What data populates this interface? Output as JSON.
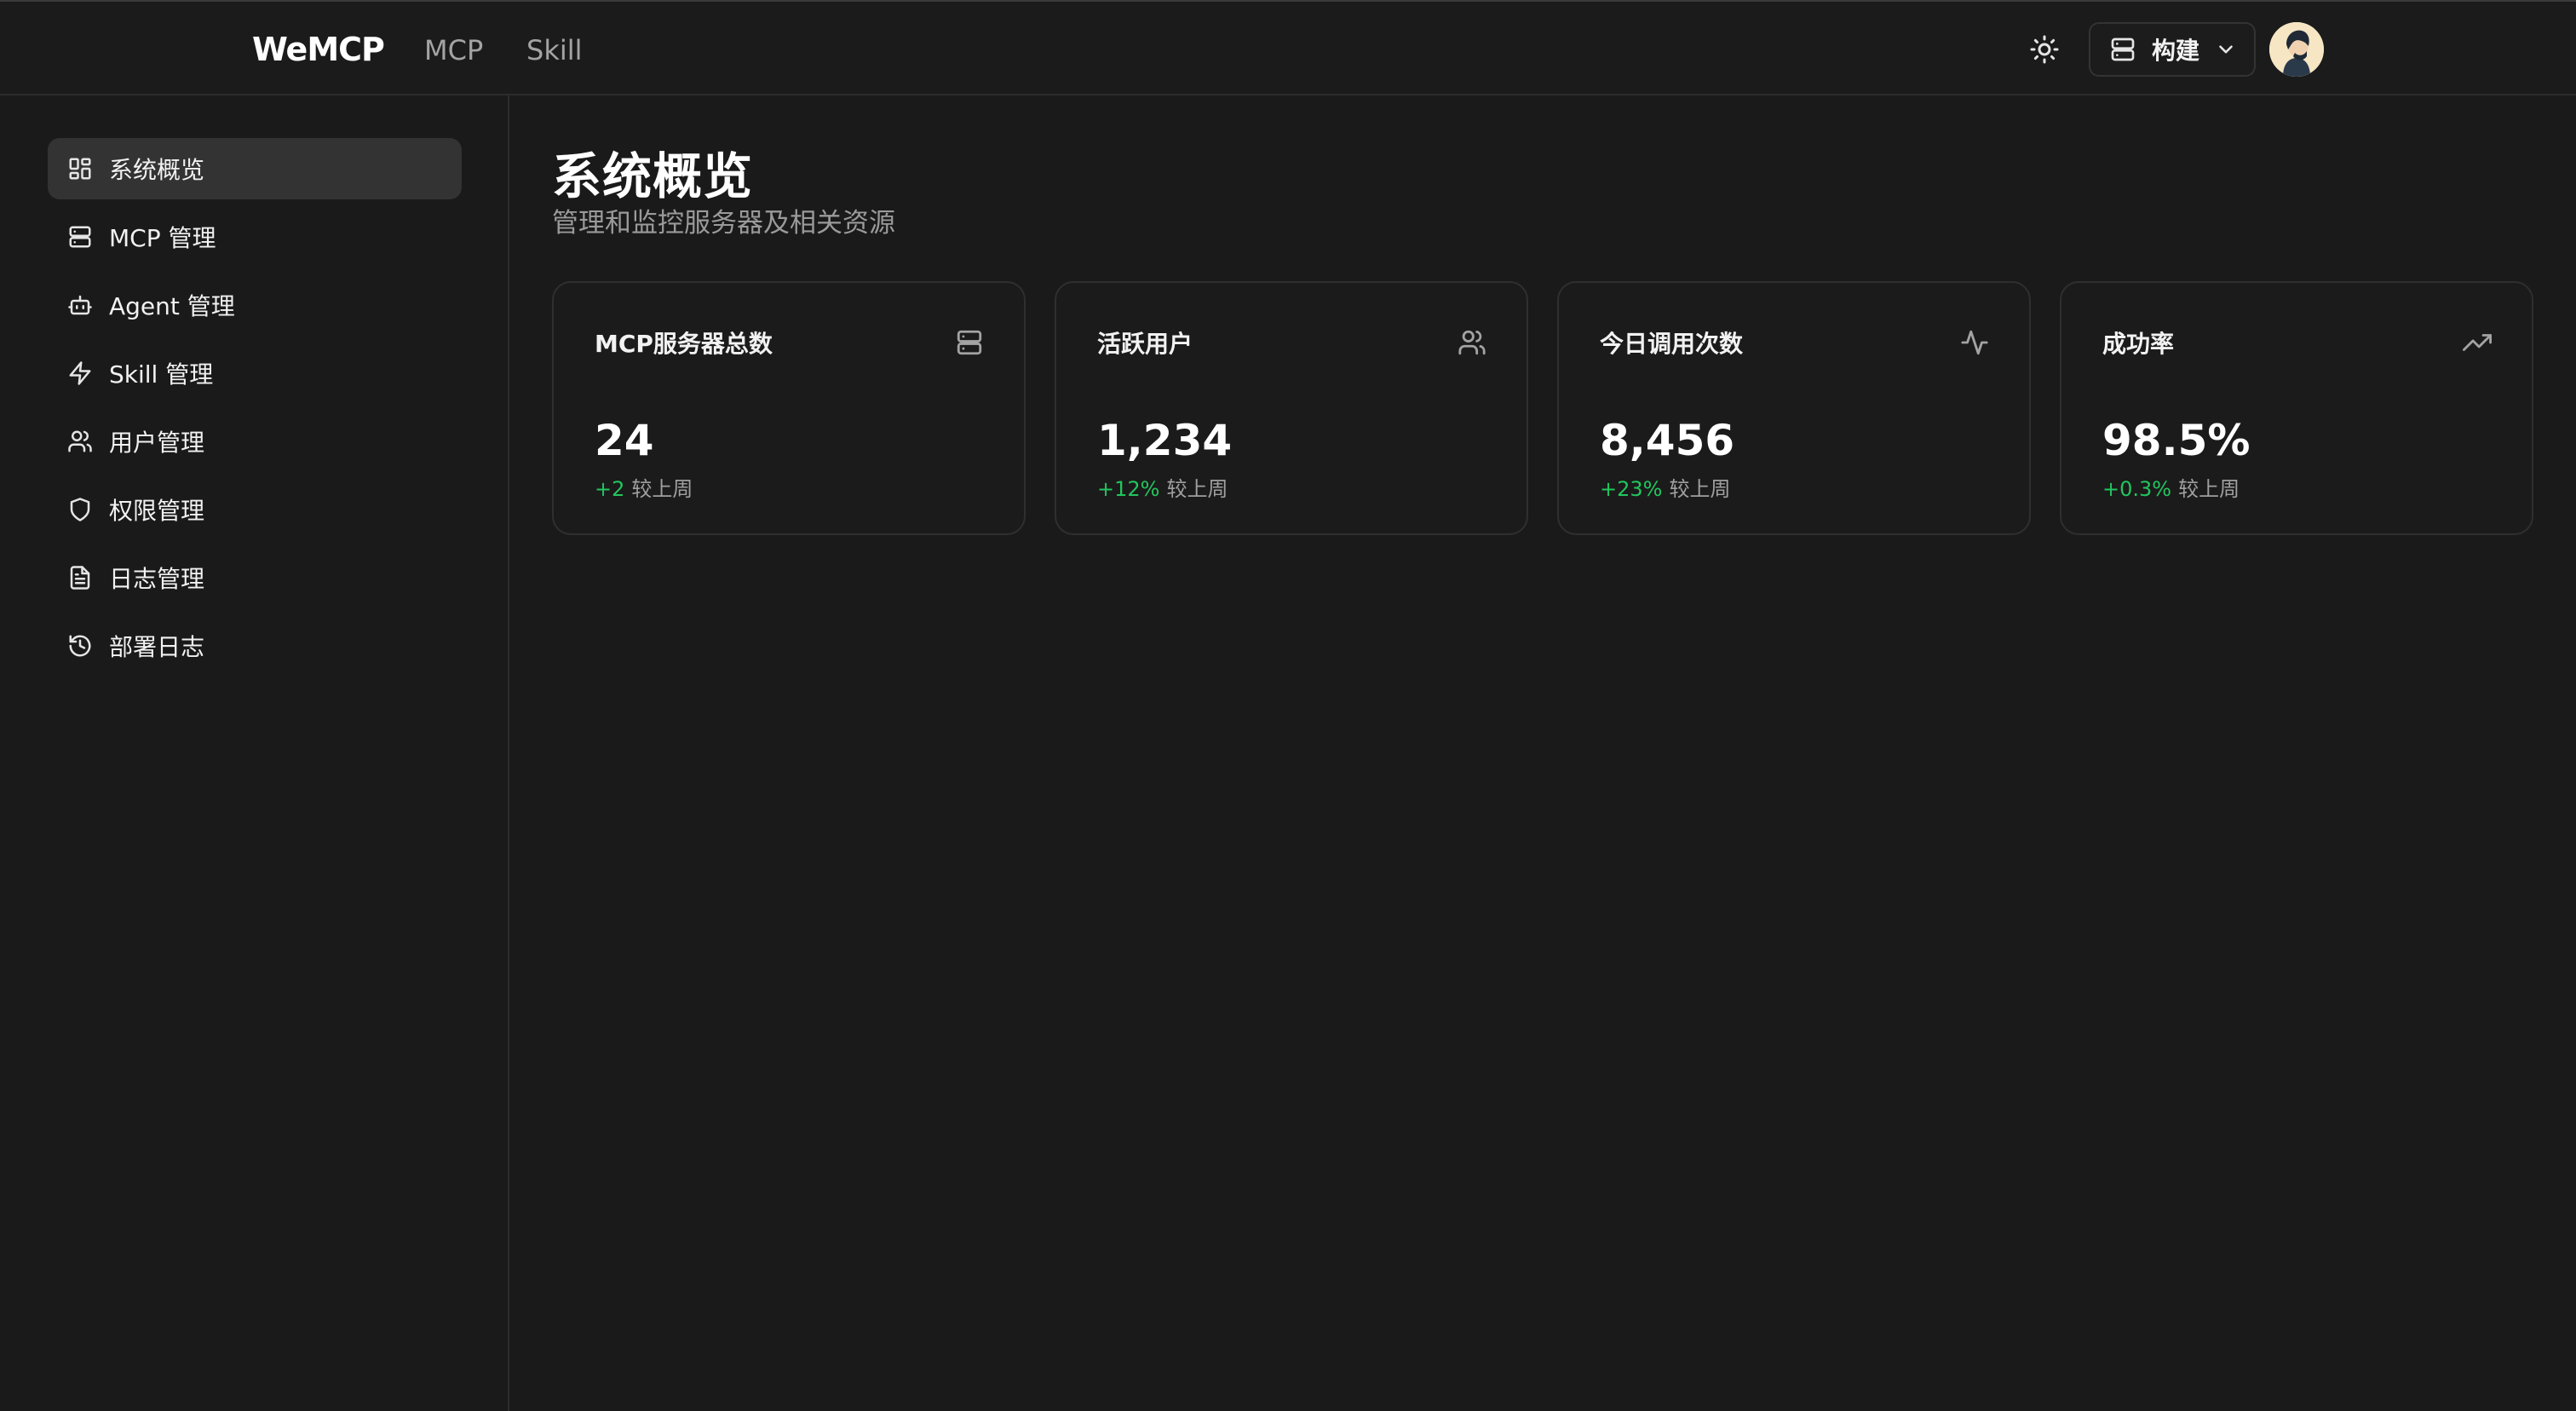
{
  "header": {
    "brand": "WeMCP",
    "nav": [
      {
        "label": "MCP"
      },
      {
        "label": "Skill"
      }
    ],
    "build_label": "构建",
    "icons": {
      "theme": "sun-icon",
      "build": "server-icon",
      "chevron": "chevron-down-icon"
    }
  },
  "sidebar": {
    "items": [
      {
        "label": "系统概览",
        "icon": "layout-dashboard-icon",
        "active": true
      },
      {
        "label": "MCP 管理",
        "icon": "server-icon"
      },
      {
        "label": "Agent 管理",
        "icon": "bot-icon"
      },
      {
        "label": "Skill 管理",
        "icon": "zap-icon"
      },
      {
        "label": "用户管理",
        "icon": "users-icon"
      },
      {
        "label": "权限管理",
        "icon": "shield-icon"
      },
      {
        "label": "日志管理",
        "icon": "file-text-icon"
      },
      {
        "label": "部署日志",
        "icon": "history-icon"
      }
    ]
  },
  "main": {
    "title": "系统概览",
    "subtitle": "管理和监控服务器及相关资源",
    "cards": [
      {
        "title": "MCP服务器总数",
        "value": "24",
        "delta": "+2",
        "delta_suffix": "较上周",
        "icon": "server-icon"
      },
      {
        "title": "活跃用户",
        "value": "1,234",
        "delta": "+12%",
        "delta_suffix": "较上周",
        "icon": "users-icon"
      },
      {
        "title": "今日调用次数",
        "value": "8,456",
        "delta": "+23%",
        "delta_suffix": "较上周",
        "icon": "activity-icon"
      },
      {
        "title": "成功率",
        "value": "98.5%",
        "delta": "+0.3%",
        "delta_suffix": "较上周",
        "icon": "trending-up-icon"
      }
    ]
  },
  "colors": {
    "background": "#1a1a1a",
    "active_item": "#333333",
    "positive": "#22c55e",
    "muted": "#9a9a9a"
  }
}
